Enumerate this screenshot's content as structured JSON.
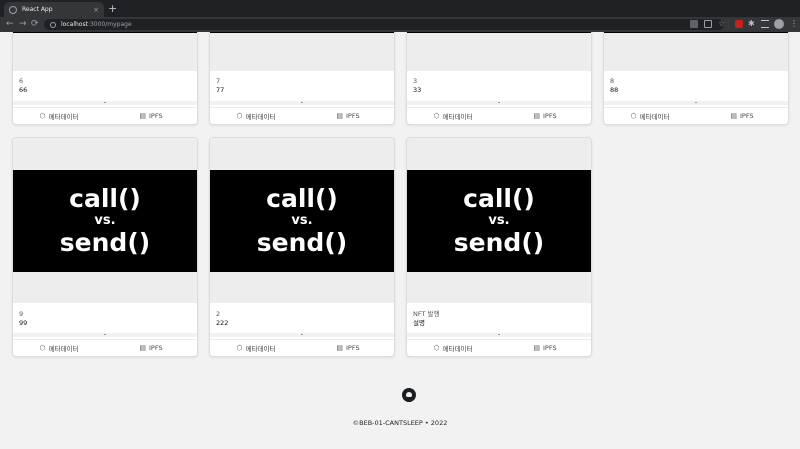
{
  "browser": {
    "tab_title": "React App",
    "tab_close": "×",
    "new_tab": "+",
    "url_host": "localhost",
    "url_path": ":3000/mypage",
    "nav": {
      "back": "←",
      "forward": "→",
      "reload": "⟳"
    },
    "icons": [
      "translate-icon",
      "share-icon",
      "bookmark-star-icon",
      "extension-icon",
      "puzzle-icon",
      "reading-list-icon",
      "profile-avatar-icon",
      "kebab-menu-icon"
    ]
  },
  "artwork": {
    "line1": "call()",
    "line2": "vs.",
    "line3": "send()"
  },
  "card_actions": {
    "metadata_label": "메타데이터",
    "ipfs_label": "IPFS"
  },
  "cards_top": [
    {
      "sub": "6",
      "main": "66"
    },
    {
      "sub": "7",
      "main": "77"
    },
    {
      "sub": "3",
      "main": "33"
    },
    {
      "sub": "8",
      "main": "88"
    }
  ],
  "cards_bottom": [
    {
      "sub": "9",
      "main": "99"
    },
    {
      "sub": "2",
      "main": "222"
    },
    {
      "sub": "NFT 발행",
      "main": "설명"
    }
  ],
  "footer": {
    "copyright": "©BEB-01-CANTSLEEP  •  2022"
  },
  "colors": {
    "page_bg": "#f2f2f2",
    "chrome_dark": "#202124",
    "card_bg": "#ffffff",
    "art_bg": "#000000"
  }
}
